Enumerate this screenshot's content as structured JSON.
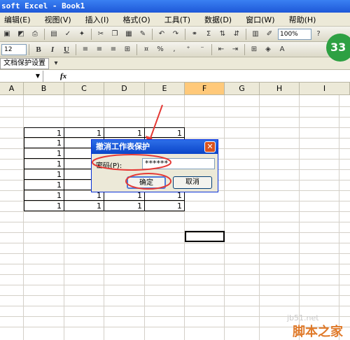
{
  "window": {
    "title": "soft Excel - Book1"
  },
  "menu": [
    "编辑(E)",
    "视图(V)",
    "插入(I)",
    "格式(O)",
    "工具(T)",
    "数据(D)",
    "窗口(W)",
    "帮助(H)"
  ],
  "toolbar": {
    "zoom": "100%",
    "font_size": "12",
    "bold": "B",
    "italic": "I",
    "underline": "U",
    "percent": "%",
    "protect_button": "文档保护设置"
  },
  "badge": "33",
  "formula_bar": {
    "fx": "fx"
  },
  "columns": [
    "A",
    "B",
    "C",
    "D",
    "E",
    "F",
    "G",
    "H",
    "I"
  ],
  "selected_column": "F",
  "table": {
    "rows": [
      [
        "1",
        "1",
        "1",
        "1"
      ],
      [
        "1",
        "",
        "",
        ""
      ],
      [
        "1",
        "",
        "",
        ""
      ],
      [
        "1",
        "",
        "",
        ""
      ],
      [
        "1",
        "",
        "",
        ""
      ],
      [
        "1",
        "",
        "",
        ""
      ],
      [
        "1",
        "1",
        "1",
        "1"
      ],
      [
        "1",
        "1",
        "1",
        "1"
      ]
    ]
  },
  "dialog": {
    "title": "撤消工作表保护",
    "password_label": "密码(P):",
    "password_value": "******",
    "ok_label": "确定",
    "cancel_label": "取消"
  },
  "watermark": {
    "url": "jb51.net",
    "name": "脚本之家"
  },
  "colors": {
    "annotation": "#e53935",
    "titlebar": "#1e58d8",
    "selected_header": "#ffc97a"
  }
}
